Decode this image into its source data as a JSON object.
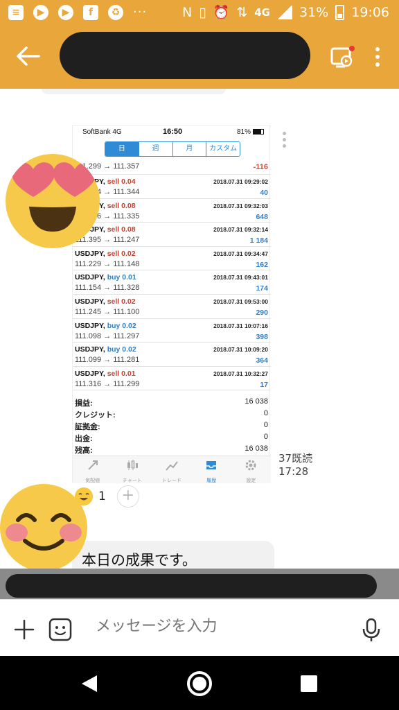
{
  "status_bar": {
    "network": "4G",
    "battery": "31%",
    "time": "19:06",
    "icons": [
      "notes-icon",
      "youtube-icon",
      "play-icon",
      "facebook-icon",
      "recycle-icon",
      "more-dots-icon",
      "nfc-icon",
      "vibrate-icon",
      "alarm-icon",
      "data-icon",
      "signal-icon",
      "battery-icon"
    ]
  },
  "colors": {
    "accent": "#e9a63a",
    "buy": "#2f7fc9",
    "sell": "#c8412f",
    "tab_active": "#2f8bd6"
  },
  "screenshot": {
    "carrier": "SoftBank  4G",
    "time": "16:50",
    "battery": "81%",
    "segments": [
      "日",
      "週",
      "月",
      "カスタム"
    ],
    "first_row": {
      "prices": "111.299 → 111.357",
      "profit": "-116"
    },
    "trades": [
      {
        "pair": "USDJPY, ",
        "side": "sell 0.04",
        "type": "sell",
        "date": "2018.07.31 09:29:02",
        "prices": "111.354 → 111.344",
        "profit": "40"
      },
      {
        "pair": "USDJPY, ",
        "side": "sell 0.08",
        "type": "sell",
        "date": "2018.07.31 09:32:03",
        "prices": "111.416 → 111.335",
        "profit": "648"
      },
      {
        "pair": "USDJPY, ",
        "side": "sell 0.08",
        "type": "sell",
        "date": "2018.07.31 09:32:14",
        "prices": "111.395 → 111.247",
        "profit": "1 184"
      },
      {
        "pair": "USDJPY, ",
        "side": "sell 0.02",
        "type": "sell",
        "date": "2018.07.31 09:34:47",
        "prices": "111.229 → 111.148",
        "profit": "162"
      },
      {
        "pair": "USDJPY, ",
        "side": "buy 0.01",
        "type": "buy",
        "date": "2018.07.31 09:43:01",
        "prices": "111.154 → 111.328",
        "profit": "174"
      },
      {
        "pair": "USDJPY, ",
        "side": "sell 0.02",
        "type": "sell",
        "date": "2018.07.31 09:53:00",
        "prices": "111.245 → 111.100",
        "profit": "290"
      },
      {
        "pair": "USDJPY, ",
        "side": "buy 0.02",
        "type": "buy",
        "date": "2018.07.31 10:07:16",
        "prices": "111.098 → 111.297",
        "profit": "398"
      },
      {
        "pair": "USDJPY, ",
        "side": "buy 0.02",
        "type": "buy",
        "date": "2018.07.31 10:09:20",
        "prices": "111.099 → 111.281",
        "profit": "364"
      },
      {
        "pair": "USDJPY, ",
        "side": "sell 0.01",
        "type": "sell",
        "date": "2018.07.31 10:32:27",
        "prices": "111.316 → 111.299",
        "profit": "17"
      }
    ],
    "summary": [
      {
        "label": "損益:",
        "value": "16 038"
      },
      {
        "label": "クレジット:",
        "value": "0"
      },
      {
        "label": "証拠金:",
        "value": "0"
      },
      {
        "label": "出金:",
        "value": "0"
      },
      {
        "label": "残高:",
        "value": "16 038"
      }
    ],
    "tabs": [
      "気配値",
      "チャート",
      "トレード",
      "履歴",
      "設定"
    ],
    "active_tab": "履歴"
  },
  "message": {
    "read_count": "37既読",
    "read_time": "17:28",
    "reaction_count": "1",
    "text": "本日の成果です。"
  },
  "input": {
    "placeholder": "メッセージを入力"
  }
}
